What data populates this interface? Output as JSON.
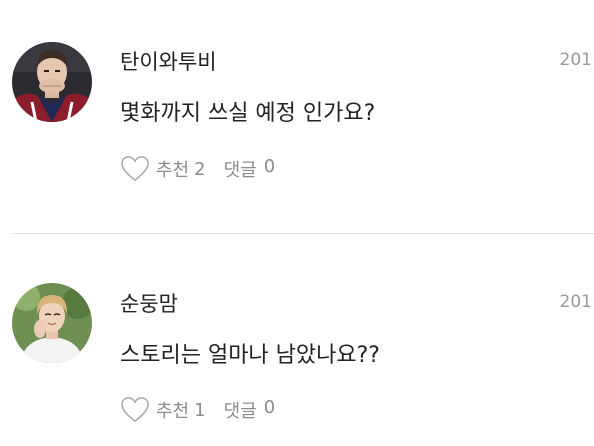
{
  "comments": [
    {
      "author": "탄이와투비",
      "date": "201",
      "text": "몇화까지 쓰실 예정 인가요?",
      "like_label": "추천",
      "like_count": "2",
      "reply_label": "댓글",
      "reply_count": "0"
    },
    {
      "author": "순둥맘",
      "date": "201",
      "text": "스토리는 얼마나 남았나요??",
      "like_label": "추천",
      "like_count": "1",
      "reply_label": "댓글",
      "reply_count": "0"
    }
  ],
  "icons": {
    "like": "heart-outline-icon"
  },
  "colors": {
    "text": "#222222",
    "muted": "#8c8c8c",
    "date": "#9a9a9a",
    "divider": "#e2e2e2"
  }
}
